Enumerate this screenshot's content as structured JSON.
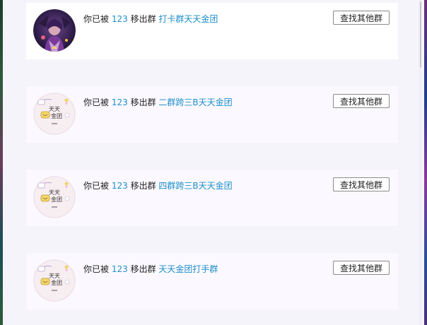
{
  "notifications": [
    {
      "prefix": "你已被",
      "user": "123",
      "action": "移出群",
      "group": "打卡群天天金团",
      "button_label": "查找其他群",
      "avatar": "dark-character-art"
    },
    {
      "prefix": "你已被",
      "user": "123",
      "action": "移出群",
      "group": "二群跨三B天天金团",
      "button_label": "查找其他群",
      "avatar": "tiantian-jintuan-logo",
      "avatar_text": [
        "天天",
        "金团"
      ]
    },
    {
      "prefix": "你已被",
      "user": "123",
      "action": "移出群",
      "group": "四群跨三B天天金团",
      "button_label": "查找其他群",
      "avatar": "tiantian-jintuan-logo",
      "avatar_text": [
        "天天",
        "金团"
      ]
    },
    {
      "prefix": "你已被",
      "user": "123",
      "action": "移出群",
      "group": "天天金团打手群",
      "button_label": "查找其他群",
      "avatar": "tiantian-jintuan-logo",
      "avatar_text": [
        "天天",
        "金团"
      ]
    }
  ],
  "colors": {
    "link": "#1e8ec9",
    "background": "#f6f4fb",
    "card": "#fbf9ff"
  }
}
